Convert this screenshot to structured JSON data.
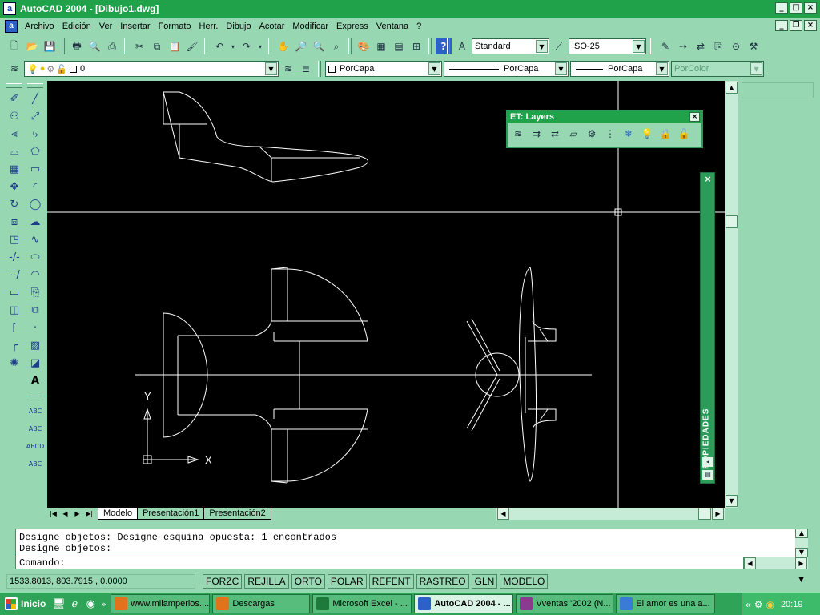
{
  "window": {
    "title": "AutoCAD 2004 - [Dibujo1.dwg]",
    "app_icon": "a"
  },
  "menu": [
    "Archivo",
    "Edición",
    "Ver",
    "Insertar",
    "Formato",
    "Herr.",
    "Dibujo",
    "Acotar",
    "Modificar",
    "Express",
    "Ventana",
    "?"
  ],
  "toolbar_styles": {
    "text_style": "Standard",
    "dim_style": "ISO-25"
  },
  "layer_toolbar": {
    "current_layer": "0",
    "color": "PorCapa",
    "linetype": "PorCapa",
    "lineweight": "PorCapa",
    "plotstyle": "PorColor"
  },
  "et_layers": {
    "title": "ET: Layers",
    "icons": [
      "layer-manager-icon",
      "layer-match-icon",
      "layer-change-icon",
      "layer-walk-icon",
      "layer-isolate-icon",
      "layer-merge-icon",
      "layer-freeze-icon",
      "layer-off-icon",
      "layer-lock-icon",
      "layer-unlock-icon"
    ]
  },
  "properties_panel": {
    "label": "PROPIEDADES"
  },
  "tabs": [
    "Modelo",
    "Presentación1",
    "Presentación2"
  ],
  "active_tab": "Modelo",
  "ucs": {
    "x_label": "X",
    "y_label": "Y"
  },
  "command": {
    "history_line_1": "Designe objetos: Designe esquina opuesta: 1 encontrados",
    "history_line_2": "Designe objetos:",
    "prompt": "Comando:"
  },
  "status": {
    "coordinates": "1533.8013, 803.7915 , 0.0000",
    "toggles": [
      "FORZC",
      "REJILLA",
      "ORTO",
      "POLAR",
      "REFENT",
      "RASTREO",
      "GLN",
      "MODELO"
    ]
  },
  "taskbar": {
    "start_label": "Inicio",
    "items": [
      {
        "label": "www.milamperios....",
        "icon": "firefox-icon",
        "color": "#e2731c"
      },
      {
        "label": "Descargas",
        "icon": "firefox-icon",
        "color": "#e2731c"
      },
      {
        "label": "Microsoft Excel - ...",
        "icon": "excel-icon",
        "color": "#1d7a3a"
      },
      {
        "label": "AutoCAD 2004 - ...",
        "icon": "autocad-icon",
        "color": "#2c62c8"
      },
      {
        "label": "Vventas '2002 (N...",
        "icon": "winrar-icon",
        "color": "#8a3b8f"
      },
      {
        "label": "El amor es una a...",
        "icon": "messenger-icon",
        "color": "#3a7bd5"
      }
    ],
    "clock": "20:19"
  },
  "colors": {
    "theme_green": "#97d8b3",
    "title_green": "#1fa24a",
    "canvas": "#000000",
    "drawing_lines": "#ffffff"
  }
}
